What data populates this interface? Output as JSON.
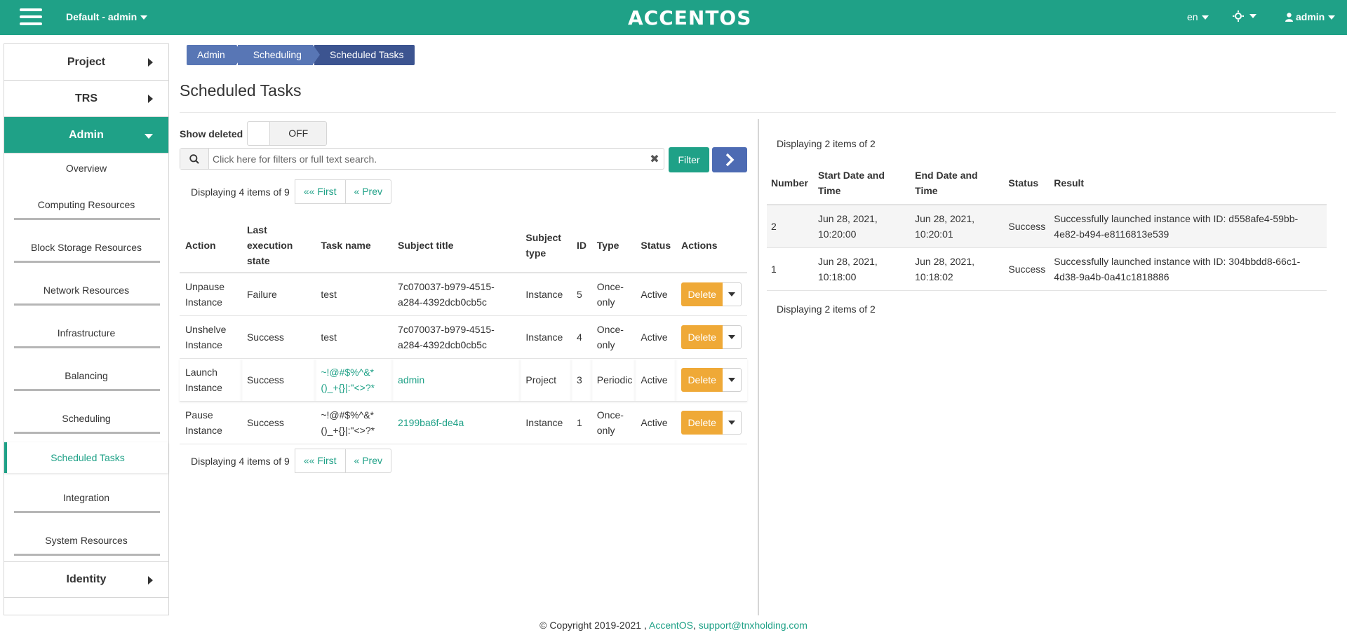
{
  "header": {
    "project": "Default - admin",
    "brand": "ACCENTOS",
    "lang": "en",
    "user": "admin",
    "accent_color": "#1fa187"
  },
  "sidebar": {
    "items": [
      {
        "label": "Project"
      },
      {
        "label": "TRS"
      },
      {
        "label": "Admin"
      }
    ],
    "admin_sub": [
      {
        "label": "Overview"
      },
      {
        "label": "Computing Resources"
      },
      {
        "label": "Block Storage Resources"
      },
      {
        "label": "Network Resources"
      },
      {
        "label": "Infrastructure"
      },
      {
        "label": "Balancing"
      },
      {
        "label": "Scheduling"
      },
      {
        "label": "Scheduled Tasks"
      },
      {
        "label": "Integration"
      },
      {
        "label": "System Resources"
      }
    ],
    "identity": "Identity"
  },
  "breadcrumb": [
    "Admin",
    "Scheduling",
    "Scheduled Tasks"
  ],
  "page_title": "Scheduled Tasks",
  "filters": {
    "show_deleted_label": "Show deleted",
    "toggle_state": "OFF",
    "search_placeholder": "Click here for filters or full text search.",
    "filter_button": "Filter"
  },
  "tasks_pager": {
    "count": "Displaying 4 items of 9",
    "first": "«« First",
    "prev": "« Prev"
  },
  "tasks_table": {
    "headers": [
      "Action",
      "Last execution state",
      "Task name",
      "Subject title",
      "Subject type",
      "ID",
      "Type",
      "Status",
      "Actions"
    ],
    "rows": [
      {
        "action": "Unpause Instance",
        "last_state": "Failure",
        "task_name": "test",
        "subject_title": "7c070037-b979-4515-a284-4392dcb0cb5c",
        "subject_type": "Instance",
        "id": "5",
        "type": "Once-only",
        "status": "Active",
        "delete": "Delete"
      },
      {
        "action": "Unshelve Instance",
        "last_state": "Success",
        "task_name": "test",
        "subject_title": "7c070037-b979-4515-a284-4392dcb0cb5c",
        "subject_type": "Instance",
        "id": "4",
        "type": "Once-only",
        "status": "Active",
        "delete": "Delete"
      },
      {
        "action": "Launch Instance",
        "last_state": "Success",
        "task_name": "~!@#$%^&*()_+{}|:\"<>?*",
        "subject_title": "admin",
        "subject_type": "Project",
        "id": "3",
        "type": "Periodic",
        "status": "Active",
        "delete": "Delete"
      },
      {
        "action": "Pause Instance",
        "last_state": "Success",
        "task_name": "~!@#$%^&*()_+{}|:\"<>?*",
        "subject_title": "2199ba6f-de4a",
        "subject_type": "Instance",
        "id": "1",
        "type": "Once-only",
        "status": "Active",
        "delete": "Delete"
      }
    ]
  },
  "results": {
    "count": "Displaying 2 items of 2",
    "headers": [
      "Number",
      "Start Date and Time",
      "End Date and Time",
      "Status",
      "Result"
    ],
    "rows": [
      {
        "number": "2",
        "start": "Jun 28, 2021, 10:20:00",
        "end": "Jun 28, 2021, 10:20:01",
        "status": "Success",
        "result": "Successfully launched instance with ID: d558afe4-59bb-4e82-b494-e8116813e539"
      },
      {
        "number": "1",
        "start": "Jun 28, 2021, 10:18:00",
        "end": "Jun 28, 2021, 10:18:02",
        "status": "Success",
        "result": "Successfully launched instance with ID: 304bbdd8-66c1-4d38-9a4b-0a41c1818886"
      }
    ]
  },
  "footer": {
    "copyright": "© Copyright 2019-2021 ,",
    "company": "AccentOS",
    "separator": ",",
    "email": "support@tnxholding.com"
  }
}
